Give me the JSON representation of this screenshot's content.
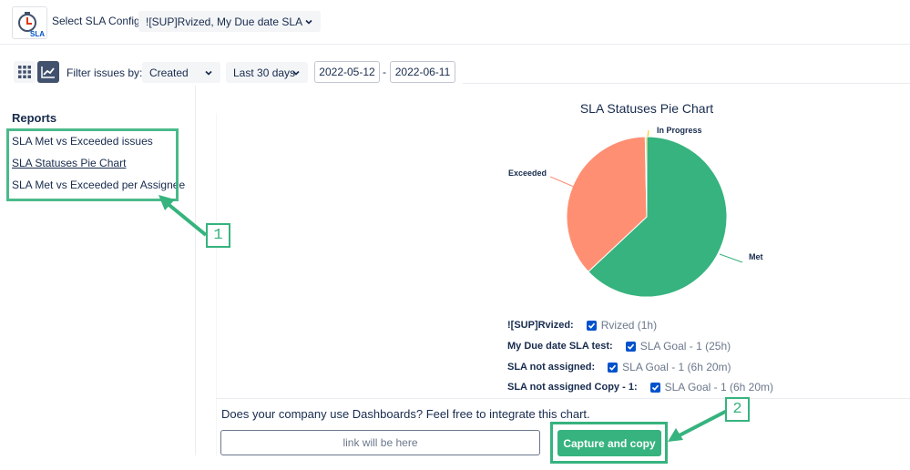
{
  "header": {
    "logo_text": "SLA",
    "config_label": "Select SLA Config",
    "config_value": "![SUP]Rvized, My Due date SLA t..."
  },
  "filters": {
    "label": "Filter issues by:",
    "field_value": "Created",
    "range_value": "Last 30 days",
    "date_from": "2022-05-12",
    "date_separator": "-",
    "date_to": "2022-06-11"
  },
  "reports": {
    "title": "Reports",
    "items": [
      {
        "label": "SLA Met vs Exceeded issues"
      },
      {
        "label": "SLA Statuses Pie Chart"
      },
      {
        "label": "SLA Met vs Exceeded per Assignee"
      }
    ]
  },
  "chart_data": {
    "type": "pie",
    "title": "SLA Statuses Pie Chart",
    "categories": [
      "Met",
      "Exceeded",
      "In Progress"
    ],
    "values": [
      63,
      36.7,
      0.3
    ],
    "colors": [
      "#36b37e",
      "#ff8f73",
      "#ffc400"
    ]
  },
  "sla_configs": [
    {
      "name": "![SUP]Rvized:",
      "goal": "Rvized (1h)",
      "checked": true
    },
    {
      "name": "My Due date SLA test:",
      "goal": "SLA Goal - 1 (25h)",
      "checked": true
    },
    {
      "name": "SLA not assigned:",
      "goal": "SLA Goal - 1 (6h 20m)",
      "checked": true
    },
    {
      "name": "SLA not assigned Copy - 1:",
      "goal": "SLA Goal - 1 (6h 20m)",
      "checked": true
    }
  ],
  "dashboard": {
    "prompt": "Does your company use Dashboards? Feel free to integrate this chart.",
    "link_placeholder": "link will be here",
    "capture_label": "Capture and copy"
  },
  "callouts": {
    "one": "1",
    "two": "2"
  },
  "colors": {
    "accent": "#36b37e",
    "primary": "#0052cc",
    "exceeded": "#ff8f73"
  }
}
